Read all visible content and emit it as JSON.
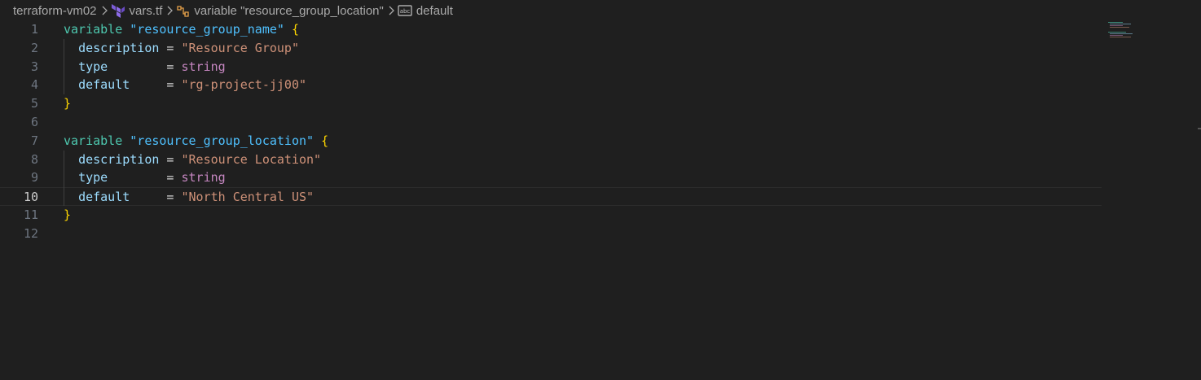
{
  "breadcrumb": {
    "folder": "terraform-vm02",
    "file": "vars.tf",
    "symbol": "variable \"resource_group_location\"",
    "property": "default"
  },
  "editor": {
    "current_line": 10,
    "lines": [
      {
        "n": "1",
        "tokens": [
          [
            "kw",
            "variable"
          ],
          [
            "op",
            " "
          ],
          [
            "name",
            "\"resource_group_name\""
          ],
          [
            "op",
            " "
          ],
          [
            "brace",
            "{"
          ]
        ]
      },
      {
        "n": "2",
        "tokens": [
          [
            "op",
            "  "
          ],
          [
            "prop",
            "description"
          ],
          [
            "op",
            " = "
          ],
          [
            "str",
            "\"Resource Group\""
          ]
        ]
      },
      {
        "n": "3",
        "tokens": [
          [
            "op",
            "  "
          ],
          [
            "prop",
            "type"
          ],
          [
            "op",
            "        = "
          ],
          [
            "type",
            "string"
          ]
        ]
      },
      {
        "n": "4",
        "tokens": [
          [
            "op",
            "  "
          ],
          [
            "prop",
            "default"
          ],
          [
            "op",
            "     = "
          ],
          [
            "str",
            "\"rg-project-jj00\""
          ]
        ]
      },
      {
        "n": "5",
        "tokens": [
          [
            "brace",
            "}"
          ]
        ]
      },
      {
        "n": "6",
        "tokens": []
      },
      {
        "n": "7",
        "tokens": [
          [
            "kw",
            "variable"
          ],
          [
            "op",
            " "
          ],
          [
            "name",
            "\"resource_group_location\""
          ],
          [
            "op",
            " "
          ],
          [
            "brace",
            "{"
          ]
        ]
      },
      {
        "n": "8",
        "tokens": [
          [
            "op",
            "  "
          ],
          [
            "prop",
            "description"
          ],
          [
            "op",
            " = "
          ],
          [
            "str",
            "\"Resource Location\""
          ]
        ]
      },
      {
        "n": "9",
        "tokens": [
          [
            "op",
            "  "
          ],
          [
            "prop",
            "type"
          ],
          [
            "op",
            "        = "
          ],
          [
            "type",
            "string"
          ]
        ]
      },
      {
        "n": "10",
        "tokens": [
          [
            "op",
            "  "
          ],
          [
            "prop",
            "default"
          ],
          [
            "op",
            "     = "
          ],
          [
            "str",
            "\"North Central US\""
          ]
        ]
      },
      {
        "n": "11",
        "tokens": [
          [
            "brace",
            "}"
          ]
        ]
      },
      {
        "n": "12",
        "tokens": []
      }
    ]
  },
  "colors": {
    "background": "#1f1f1f",
    "keyword": "#4ec9b0",
    "name": "#4fc1ff",
    "property": "#9cdcfe",
    "string": "#ce9178",
    "type": "#c586c0",
    "brace": "#ffd700"
  },
  "icons": {
    "file_icon": "terraform-icon",
    "symbol_icon": "variable-icon",
    "property_icon": "string-icon"
  }
}
